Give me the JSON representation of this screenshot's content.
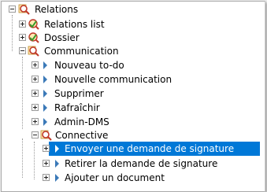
{
  "tree": {
    "nodes": [
      {
        "label": "Relations",
        "icon": "magnifier-icon",
        "expanded": true
      },
      {
        "label": "Relations list",
        "icon": "magnifier-icon",
        "expanded": false
      },
      {
        "label": "Dossier",
        "icon": "magnifier-icon",
        "expanded": false
      },
      {
        "label": "Communication",
        "icon": "magnifier-icon",
        "expanded": true
      },
      {
        "label": "Nouveau to-do",
        "icon": "arrow-icon",
        "expanded": false
      },
      {
        "label": "Nouvelle communication",
        "icon": "arrow-icon",
        "expanded": false
      },
      {
        "label": "Supprimer",
        "icon": "arrow-icon",
        "expanded": false
      },
      {
        "label": "Rafraîchir",
        "icon": "arrow-icon",
        "expanded": false
      },
      {
        "label": "Admin-DMS",
        "icon": "arrow-icon",
        "expanded": false
      },
      {
        "label": "Connective",
        "icon": "magnifier-icon",
        "expanded": true
      },
      {
        "label": "Envoyer une demande de signature",
        "icon": "arrow-icon",
        "expanded": false,
        "selected": true
      },
      {
        "label": "Retirer la demande de signature",
        "icon": "arrow-icon",
        "expanded": false
      },
      {
        "label": "Ajouter un document",
        "icon": "arrow-icon",
        "expanded": false
      }
    ]
  },
  "colors": {
    "selection": "#0078d7",
    "arrow": "#3b79b8",
    "magnifier_lens": "#c0392b",
    "magnifier_fill": "#ffe9b0",
    "green_check": "#3a9a2c"
  }
}
